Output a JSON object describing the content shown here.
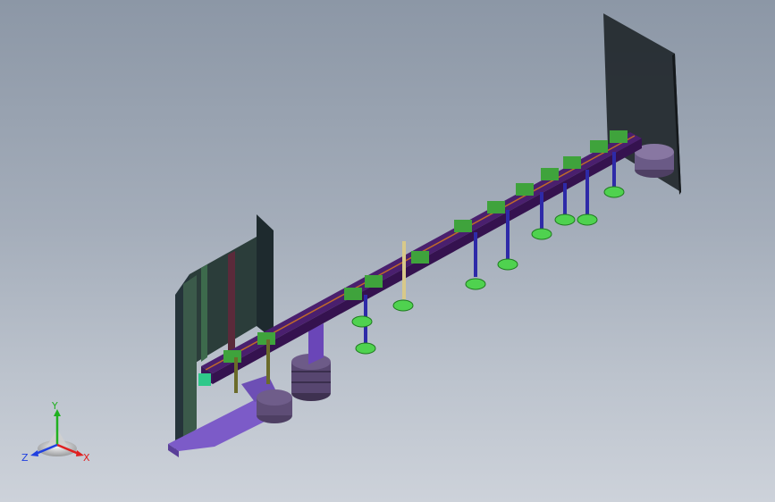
{
  "scene": {
    "description_free": true,
    "colors": {
      "background_top": "#8c97a6",
      "background_bottom": "#cdd2da",
      "beam": "#4a1f6e",
      "beam_stripe": "#c06a2a",
      "clamp": "#3fa33c",
      "suction_cup": "#4fd24f",
      "rod": "#2e2aa8",
      "plate_dark": "#1f2d33",
      "base_purple": "#6a5a86",
      "bracket_violet": "#7c5bc8"
    }
  },
  "triad": {
    "x_label": "X",
    "y_label": "Y",
    "z_label": "Z",
    "x_color": "#e02020",
    "y_color": "#20b020",
    "z_color": "#2040e0"
  }
}
